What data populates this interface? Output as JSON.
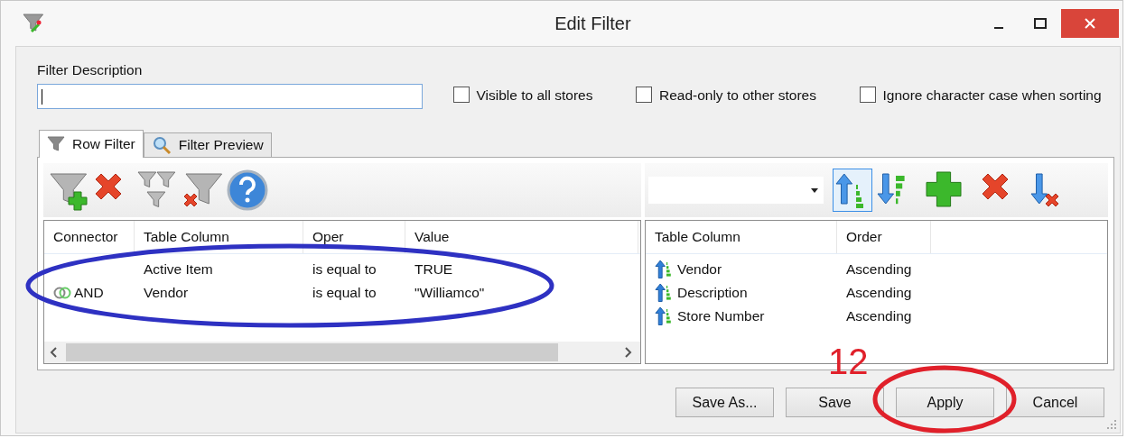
{
  "window": {
    "title": "Edit Filter"
  },
  "description": {
    "label": "Filter Description"
  },
  "options": [
    {
      "label": "Visible to all stores",
      "checked": false
    },
    {
      "label": "Read-only to other stores",
      "checked": false
    },
    {
      "label": "Ignore character case when sorting",
      "checked": false
    }
  ],
  "tabs": [
    {
      "label": "Row Filter",
      "kind": "funnel",
      "selected": true
    },
    {
      "label": "Filter Preview",
      "kind": "magnifier",
      "selected": false
    }
  ],
  "filter_toolbar": [
    {
      "kind": "add-filter"
    },
    {
      "kind": "delete"
    },
    {
      "kind": "group"
    },
    {
      "kind": "remove-filter"
    },
    {
      "kind": "help"
    }
  ],
  "filter_table": {
    "columns": [
      "Connector",
      "Table Column",
      "Oper",
      "Value"
    ],
    "rows": [
      {
        "table_column": "Active Item",
        "oper": "is equal to",
        "value": "TRUE"
      },
      {
        "connector": "AND",
        "table_column": "Vendor",
        "oper": "is equal to",
        "value": "\"Williamco\""
      }
    ]
  },
  "sort_toolbar": [
    {
      "kind": "ascending",
      "selected": true
    },
    {
      "kind": "descending",
      "selected": false
    },
    {
      "kind": "add",
      "selected": false
    },
    {
      "kind": "delete",
      "selected": false
    },
    {
      "kind": "remove-sort",
      "selected": false
    }
  ],
  "sort_table": {
    "columns": [
      "Table Column",
      "Order"
    ],
    "rows": [
      {
        "table_column": "Vendor",
        "order": "Ascending"
      },
      {
        "table_column": "Description",
        "order": "Ascending"
      },
      {
        "table_column": "Store Number",
        "order": "Ascending"
      }
    ]
  },
  "buttons": [
    "Save As...",
    "Save",
    "Apply",
    "Cancel"
  ],
  "annotations": [
    {
      "kind": "ellipse",
      "color": "#2e31c2"
    },
    {
      "kind": "ellipse",
      "color": "#e0202a"
    },
    {
      "kind": "label",
      "text": "12",
      "color": "#e0202a"
    }
  ]
}
